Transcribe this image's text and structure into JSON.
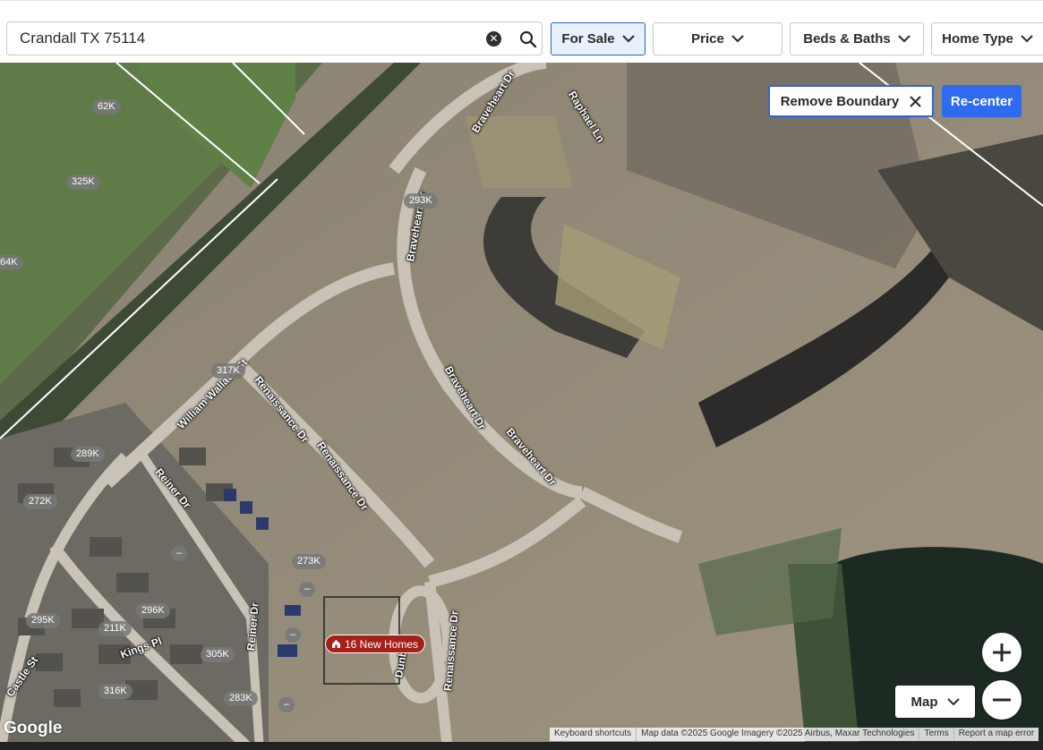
{
  "search": {
    "value": "Crandall TX 75114",
    "clear_icon": "x-circle-icon",
    "search_icon": "search-icon"
  },
  "filters": [
    {
      "label": "For Sale",
      "active": true
    },
    {
      "label": "Price",
      "active": false
    },
    {
      "label": "Beds & Baths",
      "active": false
    },
    {
      "label": "Home Type",
      "active": false
    }
  ],
  "map_controls": {
    "remove_boundary_label": "Remove Boundary",
    "recenter_label": "Re-center",
    "map_type_label": "Map",
    "zoom_in_label": "+",
    "zoom_out_label": "−"
  },
  "streets": [
    "Braveheart Dr",
    "Raphael Ln",
    "Braveheart Dr",
    "Braveheart Dr",
    "Braveheart Dr",
    "William Wallace St",
    "Renaissance Dr",
    "Renaissance Dr",
    "Reiner Dr",
    "Reiner Dr",
    "Renaissance Dr",
    "Dunbar",
    "Kings Pl",
    "Castle St"
  ],
  "price_markers": [
    "62K",
    "325K",
    "293K",
    "64K",
    "317K",
    "289K",
    "272K",
    "273K",
    "296K",
    "295K",
    "211K",
    "305K",
    "316K",
    "283K"
  ],
  "empty_markers": [
    "–",
    "–",
    "–",
    "–",
    "–"
  ],
  "cluster": {
    "label": "16 New Homes",
    "icon": "home-icon",
    "color": "#a5201a"
  },
  "branding": {
    "logo": "Google"
  },
  "attribution": [
    "Keyboard shortcuts",
    "Map data ©2025 Google Imagery ©2025 Airbus, Maxar Technologies",
    "Terms",
    "Report a map error"
  ],
  "colors": {
    "accent": "#2f6bf0",
    "boundary": "#2f62d9",
    "cluster": "#a5201a"
  }
}
